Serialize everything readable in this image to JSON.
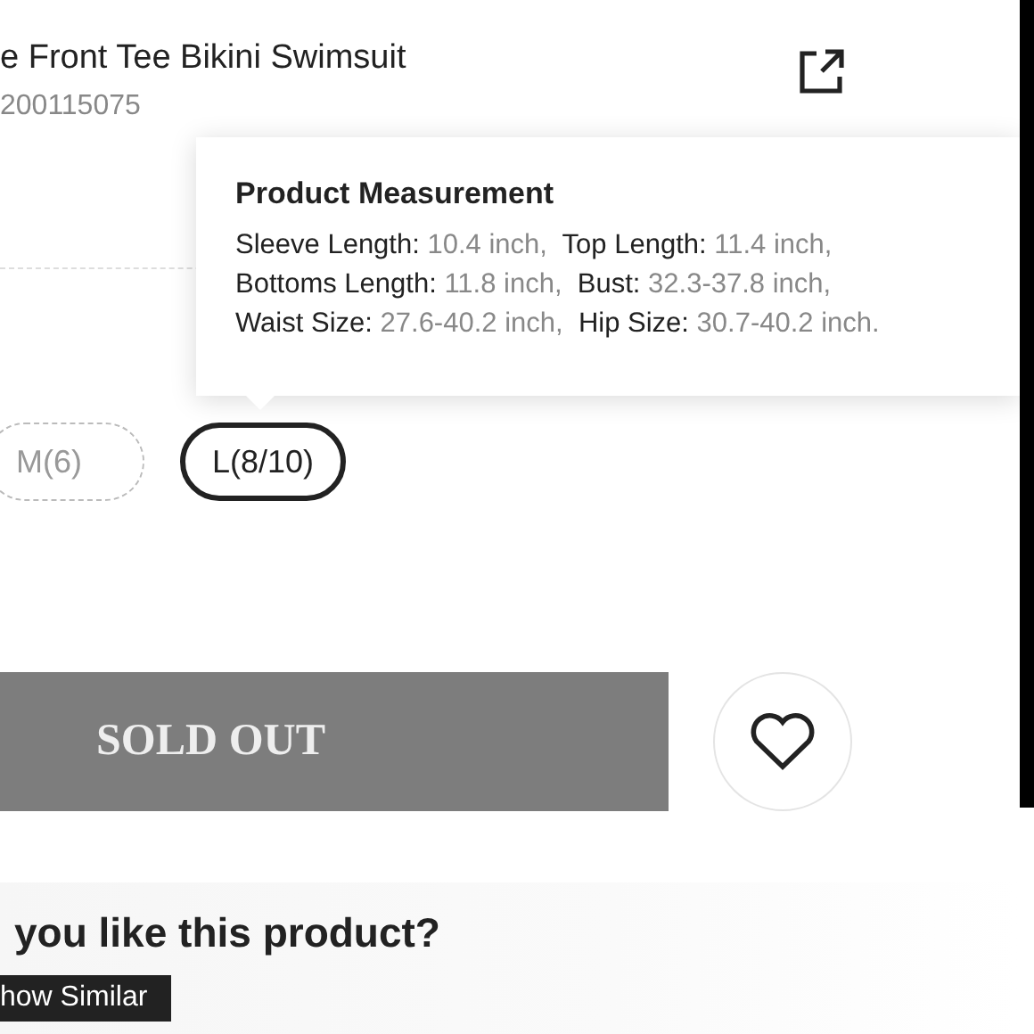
{
  "product": {
    "title": "e Front Tee Bikini Swimsuit",
    "sku": "200115075"
  },
  "measurement_popup": {
    "title": "Product Measurement",
    "lines": [
      [
        {
          "label": "Sleeve Length:",
          "value": "10.4 inch,"
        },
        {
          "label": "Top Length:",
          "value": "11.4 inch,"
        }
      ],
      [
        {
          "label": "Bottoms Length:",
          "value": "11.8 inch,"
        },
        {
          "label": "Bust:",
          "value": "32.3-37.8 inch,"
        }
      ],
      [
        {
          "label": "Waist Size:",
          "value": "27.6-40.2 inch,"
        },
        {
          "label": "Hip Size:",
          "value": "30.7-40.2 inch."
        }
      ]
    ]
  },
  "sizes": [
    {
      "label": "M(6)",
      "selected": false,
      "disabled": true
    },
    {
      "label": "L(8/10)",
      "selected": true,
      "disabled": false
    }
  ],
  "buy_button": {
    "label": "SOLD OUT",
    "disabled": true
  },
  "wishlist": {
    "saved": false
  },
  "feedback": {
    "question": "you like this product?",
    "button": "how Similar"
  }
}
